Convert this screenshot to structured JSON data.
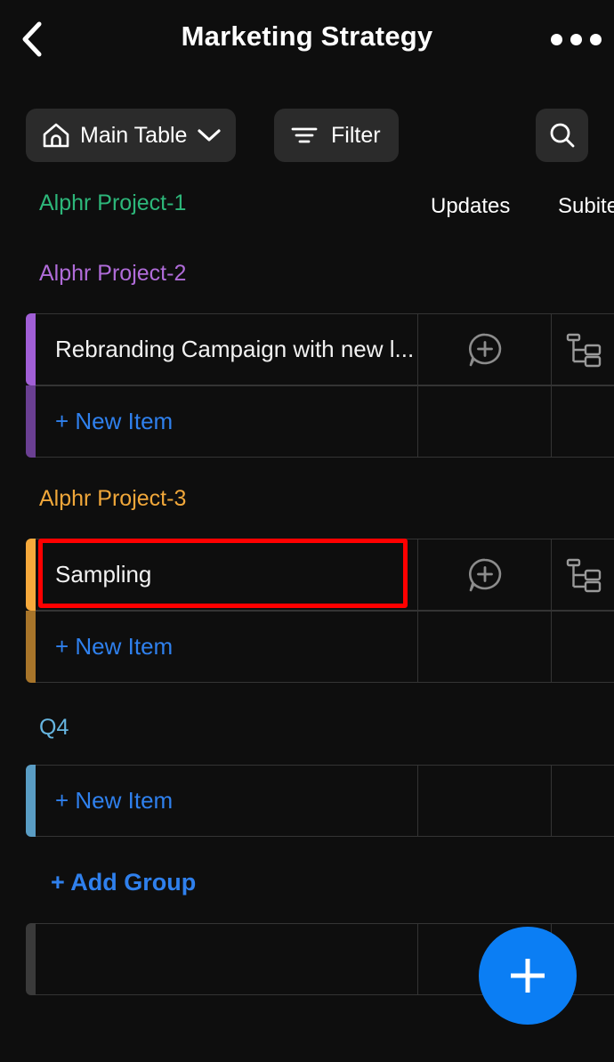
{
  "header": {
    "title": "Marketing Strategy",
    "back_icon": "chevron-left-icon",
    "more_icon": "more-horizontal-icon"
  },
  "toolbar": {
    "main_table_label": "Main Table",
    "main_table_icon": "home-icon",
    "main_table_chevron": "chevron-down-icon",
    "filter_label": "Filter",
    "filter_icon": "filter-icon",
    "search_icon": "search-icon"
  },
  "table": {
    "columns": [
      "Updates",
      "Subitems"
    ],
    "updates_icon": "comment-plus-icon",
    "subitems_icon": "subitems-tree-icon",
    "new_item_label": "+ New Item",
    "add_group_label": "+ Add Group"
  },
  "colors": {
    "background": "#0e0e0e",
    "accent_blue": "#2f80ed",
    "fab_blue": "#0b7ef4",
    "highlight_red": "#ff0000",
    "grid_line": "#343434",
    "group_green": "#2db77a",
    "group_purple": "#b06cd9",
    "group_purple_bar": "#a15fd6",
    "group_purple_bar_dim": "#6a3f92",
    "group_orange": "#f0a73a",
    "group_orange_bar": "#f5a93c",
    "group_orange_bar_dim": "#a8752a",
    "group_blue": "#66b5e0",
    "group_blue_bar": "#5a9dc4",
    "empty_row_bar": "#3a3a3a"
  },
  "groups": [
    {
      "name": "Alphr Project-1",
      "color": "#2db77a",
      "items": []
    },
    {
      "name": "Alphr Project-2",
      "color": "#b06cd9",
      "items": [
        {
          "name": "Rebranding Campaign with new l..."
        }
      ]
    },
    {
      "name": "Alphr Project-3",
      "color": "#f0a73a",
      "items": [
        {
          "name": "Sampling",
          "highlighted": true
        }
      ]
    },
    {
      "name": "Q4",
      "color": "#66b5e0",
      "items": []
    }
  ]
}
